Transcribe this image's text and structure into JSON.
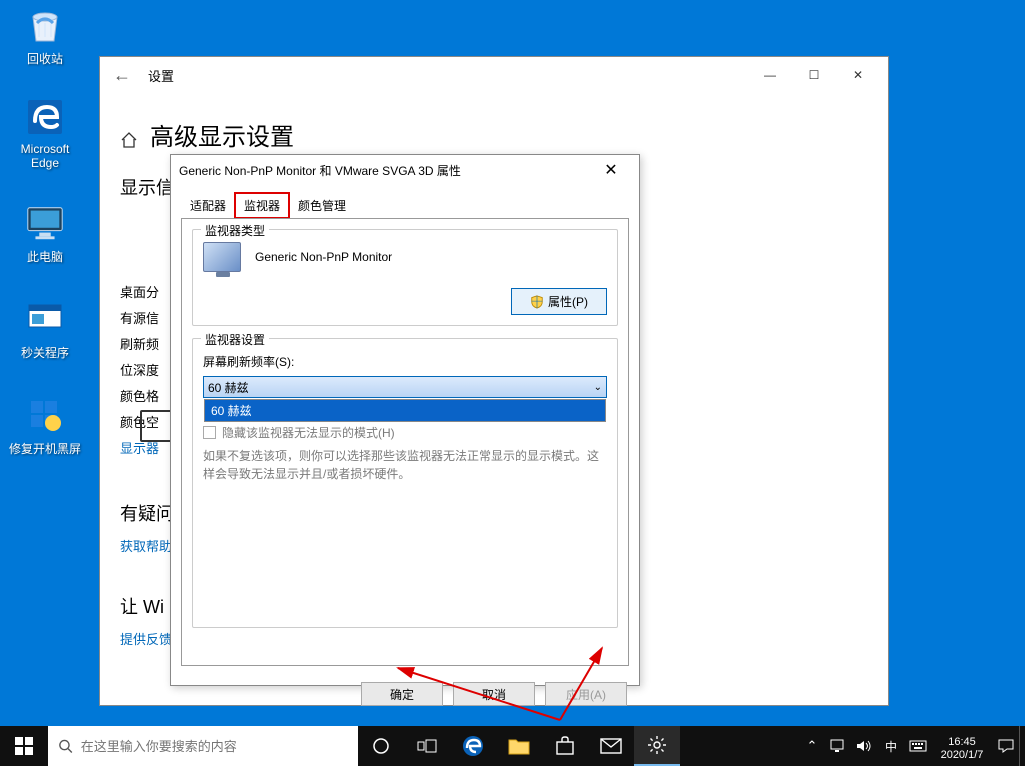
{
  "desktop": {
    "icons": [
      {
        "label": "回收站"
      },
      {
        "label": "Microsoft Edge"
      },
      {
        "label": "此电脑"
      },
      {
        "label": "秒关程序"
      },
      {
        "label": "修复开机黑屏"
      }
    ]
  },
  "settings_window": {
    "title": "设置",
    "heading": "高级显示设置",
    "section_display_info": "显示信",
    "labels": {
      "desktop_res": "桌面分",
      "active_signal": "有源信",
      "refresh": "刷新频",
      "bit_depth": "位深度",
      "color_format": "颜色格",
      "color_space": "颜色空",
      "adapter_link": "显示器"
    },
    "question_section": "有疑问",
    "help_link": "获取帮助",
    "improve_section": "让 Wi",
    "feedback_link": "提供反馈"
  },
  "properties_dialog": {
    "title": "Generic Non-PnP Monitor 和 VMware SVGA 3D 属性",
    "tabs": {
      "adapter": "适配器",
      "monitor": "监视器",
      "color": "颜色管理"
    },
    "monitor_type_group": "监视器类型",
    "monitor_name": "Generic Non-PnP Monitor",
    "properties_btn": "属性(P)",
    "monitor_settings_group": "监视器设置",
    "refresh_label": "屏幕刷新频率(S):",
    "refresh_selected": "60 赫兹",
    "refresh_option": "60 赫兹",
    "hide_modes_chk": "隐藏该监视器无法显示的模式(H)",
    "hint": "如果不复选该项，则你可以选择那些该监视器无法正常显示的显示模式。这样会导致无法显示并且/或者损坏硬件。",
    "ok_btn": "确定",
    "cancel_btn": "取消",
    "apply_btn": "应用(A)"
  },
  "taskbar": {
    "search_placeholder": "在这里输入你要搜索的内容",
    "lang": "中",
    "time": "16:45",
    "date": "2020/1/7"
  }
}
